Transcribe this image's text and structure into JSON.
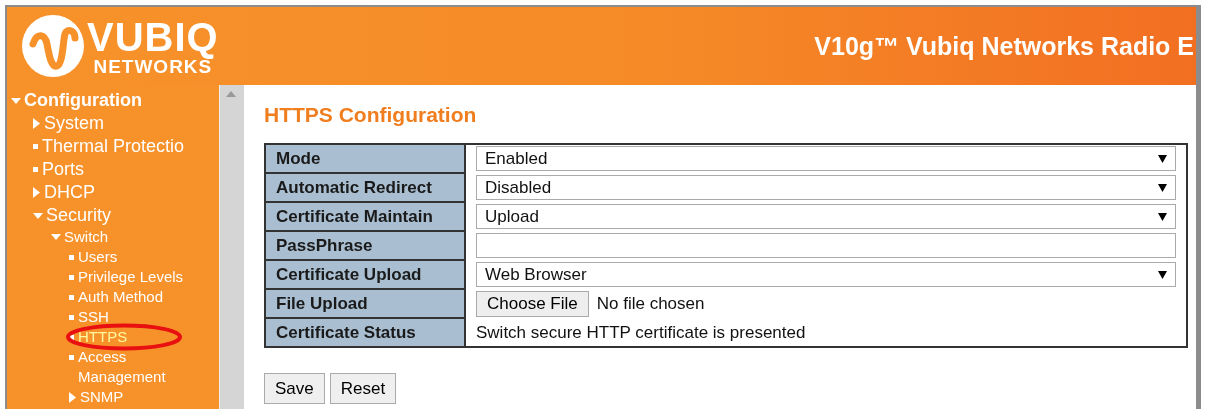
{
  "header": {
    "logo_word": "VUBIQ",
    "logo_sub": "NETWORKS",
    "title": "V10g™ Vubiq Networks Radio E"
  },
  "sidebar": {
    "items": [
      {
        "label": "Configuration",
        "kind": "folder",
        "expanded": true,
        "selected": false,
        "children": [
          {
            "label": "System",
            "kind": "folder",
            "expanded": false,
            "selected": false
          },
          {
            "label": "Thermal Protectio",
            "kind": "leaf",
            "selected": false
          },
          {
            "label": "Ports",
            "kind": "leaf",
            "selected": false
          },
          {
            "label": "DHCP",
            "kind": "folder",
            "expanded": false,
            "selected": false
          },
          {
            "label": "Security",
            "kind": "folder",
            "expanded": true,
            "selected": false,
            "children": [
              {
                "label": "Switch",
                "kind": "folder",
                "expanded": true,
                "selected": false,
                "children": [
                  {
                    "label": "Users",
                    "kind": "leaf",
                    "selected": false
                  },
                  {
                    "label": "Privilege Levels",
                    "kind": "leaf",
                    "selected": false
                  },
                  {
                    "label": "Auth Method",
                    "kind": "leaf",
                    "selected": false
                  },
                  {
                    "label": "SSH",
                    "kind": "leaf",
                    "selected": false
                  },
                  {
                    "label": "HTTPS",
                    "kind": "leaf",
                    "selected": true
                  },
                  {
                    "label": "Access Management",
                    "kind": "leaf",
                    "selected": false
                  },
                  {
                    "label": "SNMP",
                    "kind": "folder",
                    "expanded": false,
                    "selected": false
                  }
                ]
              }
            ]
          }
        ]
      }
    ]
  },
  "content": {
    "heading": "HTTPS Configuration",
    "rows": [
      {
        "label": "Mode",
        "kind": "select",
        "value": "Enabled"
      },
      {
        "label": "Automatic Redirect",
        "kind": "select",
        "value": "Disabled"
      },
      {
        "label": "Certificate Maintain",
        "kind": "select",
        "value": "Upload"
      },
      {
        "label": "PassPhrase",
        "kind": "text"
      },
      {
        "label": "Certificate Upload",
        "kind": "select",
        "value": "Web Browser"
      },
      {
        "label": "File Upload",
        "kind": "file",
        "button": "Choose File",
        "value": "No file chosen"
      },
      {
        "label": "Certificate Status",
        "kind": "status",
        "value": "Switch secure HTTP certificate is presented"
      }
    ],
    "buttons": [
      "Save",
      "Reset"
    ]
  }
}
